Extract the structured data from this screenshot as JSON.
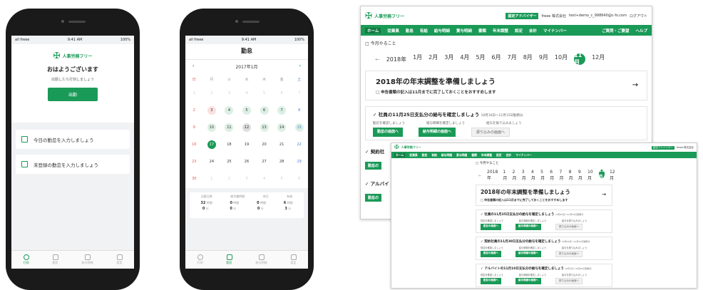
{
  "phone1": {
    "status": {
      "carrier": "all freee",
      "time": "9:41 AM",
      "battery": "100%"
    },
    "logo": "人事労務フリー",
    "greeting": "おはようございます",
    "subtext": "出勤したら打刻しましょう",
    "clockin_label": "出勤",
    "menu": [
      "今日の勤怠を入力しましょう",
      "未登録の勤怠を入力しましょう"
    ],
    "tabs": [
      "打刻",
      "勤怠",
      "給与明細",
      "設定"
    ]
  },
  "phone2": {
    "status": {
      "carrier": "all freee",
      "time": "9:41 AM",
      "battery": "100%"
    },
    "title": "勤怠",
    "month": "2017年1月",
    "weekdays": [
      "日",
      "月",
      "火",
      "水",
      "木",
      "金",
      "土"
    ],
    "weeks": [
      [
        "1",
        "2",
        "3",
        "4",
        "5",
        "6",
        "7"
      ],
      [
        "2",
        "3",
        "4",
        "5",
        "6",
        "7",
        "8"
      ],
      [
        "9",
        "10",
        "11",
        "12",
        "13",
        "14",
        "15"
      ],
      [
        "16",
        "17",
        "18",
        "19",
        "20",
        "21",
        "22"
      ],
      [
        "23",
        "24",
        "25",
        "26",
        "27",
        "28",
        "29"
      ],
      [
        "30",
        "1",
        "2",
        "3",
        "4",
        "5",
        "6"
      ]
    ],
    "selected_day": "17",
    "summary_heads": [
      "出勤日数",
      "総労働時間",
      "休日",
      "有給"
    ],
    "summary_row1": [
      "32",
      "時間",
      "0",
      "時間",
      "0",
      "時間",
      "6",
      "時間"
    ],
    "summary_row2": [
      "0",
      "分",
      "0",
      "分",
      "0",
      "分",
      "3",
      "分"
    ],
    "tabs": [
      "打刻",
      "勤怠",
      "給与明細",
      "設定"
    ]
  },
  "desktop": {
    "logo": "人事労務フリー",
    "header_badge": "認定アドバイザー",
    "header_company": "freee 株式会社",
    "header_email": "test+demo_c_998640@c-fs.com",
    "header_logout": "ログアウト",
    "nav": [
      "ホーム",
      "従業員",
      "勤怠",
      "有給",
      "給与明細",
      "賞与明細",
      "書類",
      "年末調整",
      "設定",
      "会計",
      "マイナンバー"
    ],
    "nav_right": [
      "ご質問・ご要望",
      "ヘルプ"
    ],
    "todo_title": "今月やること",
    "year": "2018年",
    "months": [
      "1月",
      "2月",
      "3月",
      "4月",
      "5月",
      "6月",
      "7月",
      "8月",
      "9月",
      "10月",
      "11月",
      "12月"
    ],
    "active_month": "11",
    "hero_title": "2018年の年末調整を準備しましょう",
    "hero_sub": "申告書類の記入は11月までに完了しておくことをおすすめします",
    "task1_title": "社員の11月25日支払分の給与を確定しましょう",
    "task1_date": "10月16日〜11月15日勤務分",
    "task1_steps": [
      "勤怠を確認しましょう",
      "給与明細を確定しましょう",
      "給与を振り込みましょう"
    ],
    "task1_buttons": [
      "勤怠の画面へ",
      "給与明細の画面へ",
      "振り込みの画面へ"
    ],
    "task2_title_short": "契約社",
    "task3_title_short": "アルバイ",
    "btn_short": "勤怠の"
  },
  "desktop2": {
    "task2_title": "契約社員の11月30日支払分の給与を確定しましょう",
    "task2_date": "10月16日〜11月15日勤務分",
    "task3_title": "アルバイトの11月10日支払分の給与を確定しましょう",
    "task3_date": "10月1日〜10月31日勤務分"
  }
}
